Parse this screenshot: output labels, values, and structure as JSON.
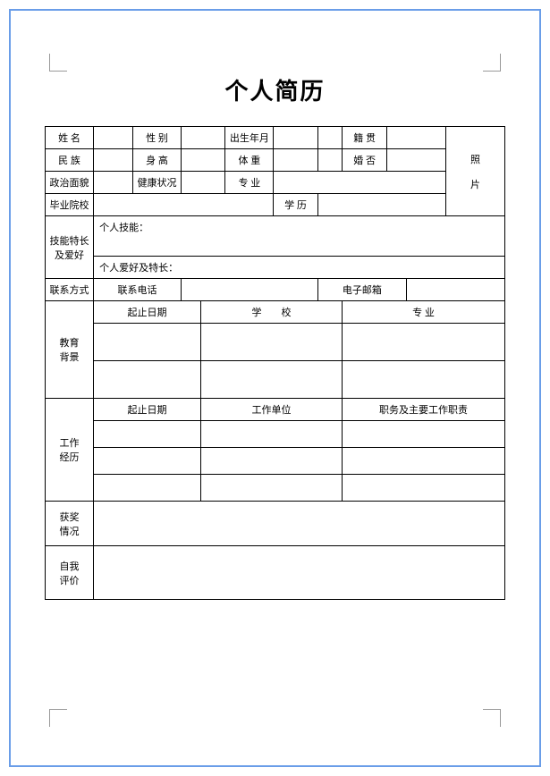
{
  "title": "个人简历",
  "row1": {
    "name_label": "姓 名",
    "gender_label": "性 别",
    "birth_label": "出生年月",
    "native_label": "籍 贯"
  },
  "row2": {
    "ethnicity_label": "民 族",
    "height_label": "身 高",
    "weight_label": "体 重",
    "marriage_label": "婚 否"
  },
  "row3": {
    "politics_label": "政治面貌",
    "health_label": "健康状况",
    "major_label": "专 业"
  },
  "row4": {
    "school_label": "毕业院校",
    "degree_label": "学 历"
  },
  "photo_label": "照片",
  "skills": {
    "section_label": "技能特长及爱好",
    "skills_header": "个人技能：",
    "hobbies_header": "个人爱好及特长："
  },
  "contact": {
    "section_label": "联系方式",
    "phone_label": "联系电话",
    "email_label": "电子邮箱"
  },
  "education": {
    "section_label": "教育背景",
    "date_header": "起止日期",
    "school_header": "学　　校",
    "major_header": "专 业"
  },
  "work": {
    "section_label": "工作经历",
    "date_header": "起止日期",
    "company_header": "工作单位",
    "duty_header": "职务及主要工作职责"
  },
  "awards_label": "获奖情况",
  "self_eval_label": "自我评价"
}
